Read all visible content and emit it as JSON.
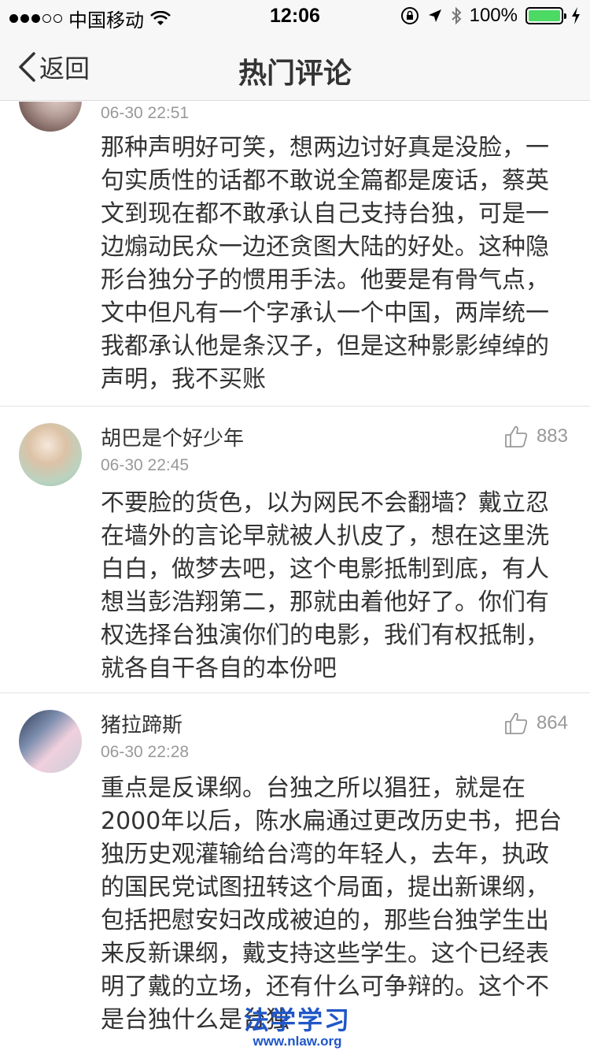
{
  "status_bar": {
    "carrier": "中国移动",
    "time": "12:06",
    "battery": "100%"
  },
  "nav": {
    "back_label": "返回",
    "title": "热门评论"
  },
  "comments": [
    {
      "username": "",
      "time": "06-30 22:51",
      "likes": "",
      "text": "那种声明好可笑，想两边讨好真是没脸，一句实质性的话都不敢说全篇都是废话，蔡英文到现在都不敢承认自己支持台独，可是一边煽动民众一边还贪图大陆的好处。这种隐形台独分子的惯用手法。他要是有骨气点，文中但凡有一个字承认一个中国，两岸统一我都承认他是条汉子，但是这种影影绰绰的声明，我不买账"
    },
    {
      "username": "胡巴是个好少年",
      "time": "06-30 22:45",
      "likes": "883",
      "text": "不要脸的货色，以为网民不会翻墙？戴立忍在墙外的言论早就被人扒皮了，想在这里洗白白，做梦去吧，这个电影抵制到底，有人想当彭浩翔第二，那就由着他好了。你们有权选择台独演你们的电影，我们有权抵制，就各自干各自的本份吧"
    },
    {
      "username": "猪拉蹄斯",
      "time": "06-30 22:28",
      "likes": "864",
      "text": "重点是反课纲。台独之所以猖狂，就是在2000年以后，陈水扁通过更改历史书，把台独历史观灌输给台湾的年轻人，去年，执政的国民党试图扭转这个局面，提出新课纲，包括把慰安妇改成被迫的，那些台独学生出来反新课纲，戴支持这些学生。这个已经表明了戴的立场，还有什么可争辩的。这个不是台独什么是台独"
    }
  ],
  "watermark": {
    "title": "法学学习",
    "url": "www.nlaw.org"
  },
  "colors": {
    "text": "#333333",
    "meta": "#999999",
    "battery": "#4cd964",
    "watermark": "#1f56c8"
  }
}
